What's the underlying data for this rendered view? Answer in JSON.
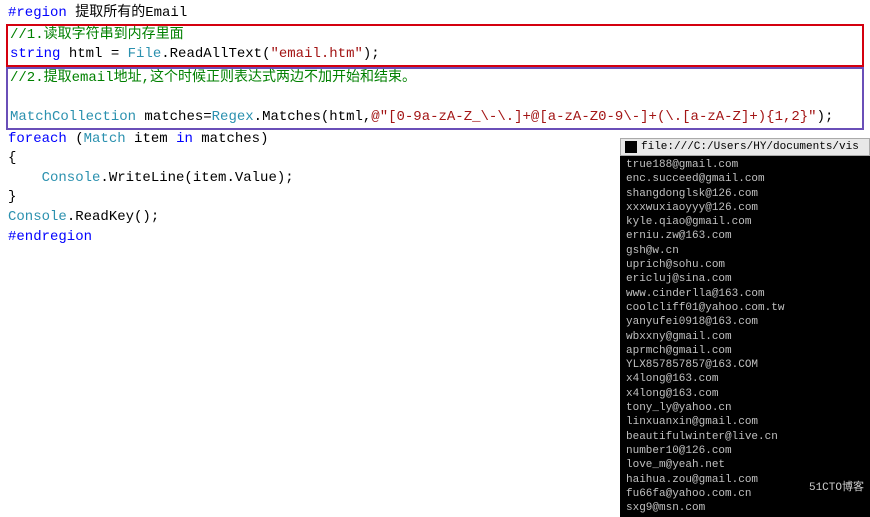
{
  "code": {
    "line1_region": "#region",
    "line1_text": " 提取所有的Email",
    "line2": "//1.读取字符串到内存里面",
    "line3_kw1": "string",
    "line3_txt1": " html = ",
    "line3_type": "File",
    "line3_txt2": ".ReadAllText(",
    "line3_str": "\"email.htm\"",
    "line3_txt3": ");",
    "line4": "//2.提取email地址,这个时候正则表达式两边不加开始和结束。",
    "line5_type1": "MatchCollection",
    "line5_txt1": " matches=",
    "line5_type2": "Regex",
    "line5_txt2": ".Matches(html,",
    "line5_str": "@\"[0-9a-zA-Z_\\-\\.]+@[a-zA-Z0-9\\-]+(\\.[a-zA-Z]+){1,2}\"",
    "line5_txt3": ");",
    "line6_kw1": "foreach",
    "line6_txt1": " (",
    "line6_type": "Match",
    "line6_txt2": " item ",
    "line6_kw2": "in",
    "line6_txt3": " matches)",
    "line7": "{",
    "line8_type": "    Console",
    "line8_txt": ".WriteLine(item.Value);",
    "line9": "}",
    "line10_type": "Console",
    "line10_txt": ".ReadKey();",
    "line11": "#endregion"
  },
  "console": {
    "title": "file:///C:/Users/HY/documents/vis",
    "lines": [
      "true188@gmail.com",
      "enc.succeed@gmail.com",
      "shangdonglsk@126.com",
      "xxxwuxiaoyyy@126.com",
      "kyle.qiao@gmail.com",
      "erniu.zw@163.com",
      "gsh@w.cn",
      "uprich@sohu.com",
      "ericluj@sina.com",
      "www.cinderlla@163.com",
      "coolcliff01@yahoo.com.tw",
      "yanyufei0918@163.com",
      "wbxxny@gmail.com",
      "aprmch@gmail.com",
      "YLX857857857@163.COM",
      "x4long@163.com",
      "x4long@163.com",
      "tony_ly@yahoo.cn",
      "linxuanxin@gmail.com",
      "beautifulwinter@live.cn",
      "number10@126.com",
      "love_m@yeah.net",
      "haihua.zou@gmail.com",
      "fu66fa@yahoo.com.cn",
      "sxg9@msn.com"
    ]
  },
  "watermark": "51CTO博客"
}
